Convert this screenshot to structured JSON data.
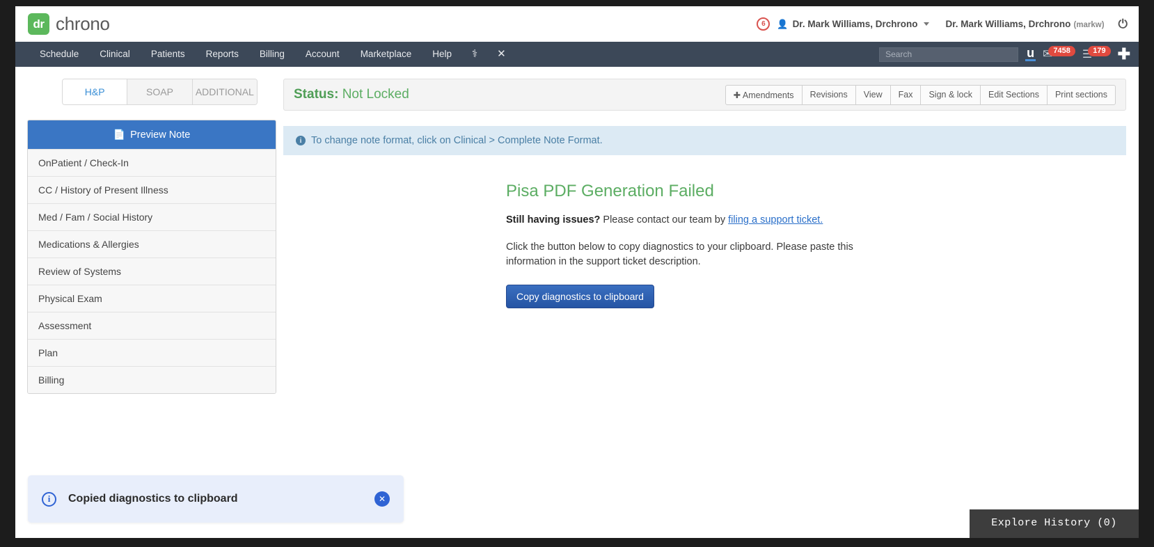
{
  "brand": {
    "mark": "dr",
    "name": "chrono",
    "accent": "#5cb85c"
  },
  "topbar": {
    "alert_count": "6",
    "person_icon": "person-icon",
    "user_menu_label": "Dr. Mark Williams, Drchrono",
    "user_display_name": "Dr. Mark Williams, Drchrono",
    "user_handle": "(markw)",
    "power_icon": "⏻"
  },
  "nav": {
    "items": [
      {
        "label": "Schedule"
      },
      {
        "label": "Clinical"
      },
      {
        "label": "Patients"
      },
      {
        "label": "Reports"
      },
      {
        "label": "Billing"
      },
      {
        "label": "Account"
      },
      {
        "label": "Marketplace"
      },
      {
        "label": "Help"
      }
    ],
    "icons": [
      {
        "name": "caduceus-icon",
        "glyph": "⚕"
      },
      {
        "name": "close-icon",
        "glyph": "✕"
      }
    ],
    "search": {
      "placeholder": "Search",
      "value": ""
    },
    "u_icon_label": "u",
    "envelope_glyph": "✉",
    "messages_count": "7458",
    "list_glyph": "☰",
    "tasks_count": "179",
    "plus_glyph": "✚"
  },
  "note_tabs": [
    {
      "label": "H&P",
      "active": true
    },
    {
      "label": "SOAP",
      "active": false
    },
    {
      "label": "ADDITIONAL",
      "active": false
    }
  ],
  "sidebar": {
    "preview_button": "Preview Note",
    "preview_icon": "document-icon",
    "items": [
      {
        "label": "OnPatient / Check-In"
      },
      {
        "label": "CC / History of Present Illness"
      },
      {
        "label": "Med / Fam / Social History"
      },
      {
        "label": "Medications & Allergies"
      },
      {
        "label": "Review of Systems"
      },
      {
        "label": "Physical Exam"
      },
      {
        "label": "Assessment"
      },
      {
        "label": "Plan"
      },
      {
        "label": "Billing"
      }
    ]
  },
  "status": {
    "label": "Status:",
    "value": "Not Locked",
    "color": "#5cad63"
  },
  "toolbar": {
    "buttons": [
      {
        "label": "Amendments",
        "icon": "plus-icon"
      },
      {
        "label": "Revisions"
      },
      {
        "label": "View"
      },
      {
        "label": "Fax"
      },
      {
        "label": "Sign & lock"
      },
      {
        "label": "Edit Sections"
      },
      {
        "label": "Print sections"
      }
    ]
  },
  "info_banner": {
    "icon": "info-icon",
    "text": "To change note format, click on Clinical > Complete Note Format."
  },
  "error": {
    "title": "Pisa PDF Generation Failed",
    "lead_bold": "Still having issues?",
    "lead_rest": " Please contact our team by ",
    "link_text": "filing a support ticket.",
    "paragraph": "Click the button below to copy diagnostics to your clipboard. Please paste this information in the support ticket description.",
    "button_label": "Copy diagnostics to clipboard"
  },
  "toast": {
    "icon": "info-circle-icon",
    "message": "Copied diagnostics to clipboard",
    "close_glyph": "✕"
  },
  "explore_history": {
    "label": "Explore History (0)"
  }
}
